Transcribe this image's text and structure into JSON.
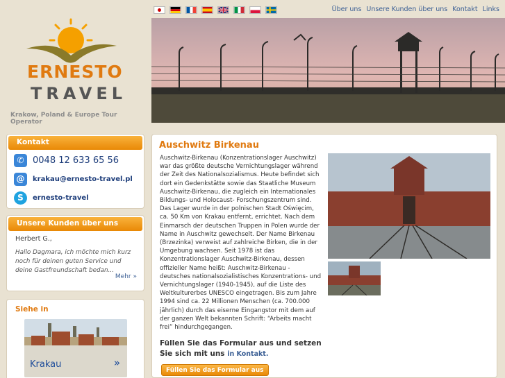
{
  "logo": {
    "brand_line1": "ERNESTO",
    "brand_line2": "TRAVEL",
    "tagline": "Krakow, Poland & Europe Tour Operator"
  },
  "languages": [
    "Japanese",
    "German",
    "French",
    "Spanish",
    "English",
    "Italian",
    "Polish",
    "Swedish"
  ],
  "topnav": [
    "Über uns",
    "Unsere Kunden über uns",
    "Kontakt",
    "Links"
  ],
  "contact": {
    "title": "Kontakt",
    "phone": "0048 12 633 65 56",
    "email": "krakau@ernesto-travel.pl",
    "skype": "ernesto-travel"
  },
  "testimonials": {
    "title": "Unsere Kunden über uns",
    "name": "Herbert G.,",
    "quote": "Hallo Dagmara, ich möchte mich kurz noch für deinen guten Service und deine Gastfreundschaft bedan...",
    "more": "Mehr »"
  },
  "see": {
    "title": "Siehe in",
    "city": "Krakau",
    "arrow": "»"
  },
  "main": {
    "title": "Auschwitz Birkenau",
    "body": "Auschwitz-Birkenau (Konzentrationslager Auschwitz) war das größte deutsche Vernichtungslager während der Zeit des Nationalsozialismus. Heute befindet sich dort ein Gedenkstätte sowie das Staatliche Museum Auschwitz-Birkenau, die zugleich ein Internationales Bildungs- und Holocaust- Forschungszentrum sind. Das Lager wurde in der polnischen Stadt Oświęcim, ca. 50 Km von Krakau entfernt, errichtet. Nach dem Einmarsch der deutschen Truppen in Polen wurde der Name in Auschwitz gewechselt. Der Name Birkenau (Brzezinka) verweist auf zahlreiche Birken, die in der Umgebung wachsen. Seit 1978 ist das Konzentrationslager Auschwitz-Birkenau, dessen offizieller Name heißt: Auschwitz-Birkenau - deutsches nationalsozialistisches Konzentrations- und Vernichtungslager (1940-1945), auf die Liste des Weltkulturerbes UNESCO eingetragen. Bis zum Jahre 1994 sind ca. 22 Millionen Menschen (ca. 700.000 jährlich) durch das eiserne Eingangstor mit dem auf der ganzen Welt bekannten Schrift: “Arbeits macht frei” hindurchgegangen.",
    "cta_text": "Füllen Sie das Formular aus und setzen Sie sich mit uns",
    "cta_link": "in Kontakt.",
    "button": "Füllen Sie das Formular aus"
  },
  "colors": {
    "accent": "#e98906",
    "link": "#3a5e94",
    "background": "#e9e2d2"
  }
}
